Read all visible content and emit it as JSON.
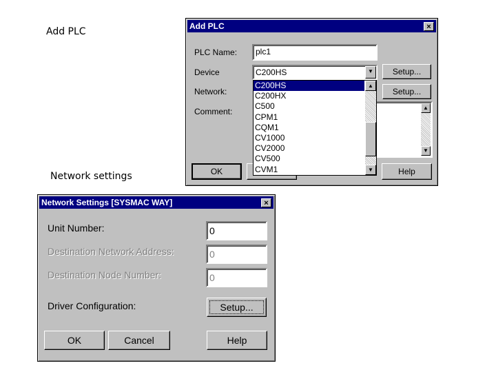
{
  "captions": {
    "add_plc": "Add PLC",
    "network": "Network settings"
  },
  "add_plc_dialog": {
    "title": "Add PLC",
    "close": "×",
    "plc_name_label": "PLC Name:",
    "plc_name_value": "plc1",
    "device_label": "Device",
    "device_value": "C200HS",
    "network_label": "Network:",
    "comment_label": "Comment:",
    "setup1": "Setup...",
    "setup2": "Setup...",
    "ok": "OK",
    "help": "Help",
    "device_options": [
      "C200HS",
      "C200HX",
      "C500",
      "CPM1",
      "CQM1",
      "CV1000",
      "CV2000",
      "CV500",
      "CVM1"
    ],
    "selected_option": "C200HS"
  },
  "network_dialog": {
    "title": "Network Settings [SYSMAC WAY]",
    "close": "×",
    "unit_label": "Unit Number:",
    "unit_value": "0",
    "dest_net_label": "Destination Network Address:",
    "dest_net_value": "0",
    "dest_node_label": "Destination Node Number:",
    "dest_node_value": "0",
    "driver_label": "Driver Configuration:",
    "setup": "Setup...",
    "ok": "OK",
    "cancel": "Cancel",
    "help": "Help"
  }
}
